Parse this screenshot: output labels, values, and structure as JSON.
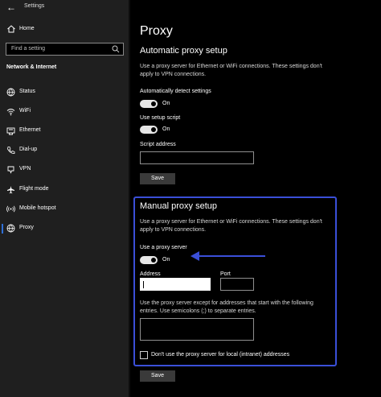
{
  "window": {
    "title": "Settings"
  },
  "sidebar": {
    "home_label": "Home",
    "search_placeholder": "Find a setting",
    "section_heading": "Network & Internet",
    "items": [
      {
        "label": "Status",
        "icon": "globe-icon"
      },
      {
        "label": "WiFi",
        "icon": "wifi-icon"
      },
      {
        "label": "Ethernet",
        "icon": "ethernet-icon"
      },
      {
        "label": "Dial-up",
        "icon": "phone-icon"
      },
      {
        "label": "VPN",
        "icon": "vpn-icon"
      },
      {
        "label": "Flight mode",
        "icon": "airplane-icon"
      },
      {
        "label": "Mobile hotspot",
        "icon": "hotspot-icon"
      },
      {
        "label": "Proxy",
        "icon": "globe-icon"
      }
    ],
    "selected_item": "Proxy"
  },
  "main": {
    "title": "Proxy",
    "automatic": {
      "heading": "Automatic proxy setup",
      "description": "Use a proxy server for Ethernet or WiFi connections. These settings don't apply to VPN connections.",
      "auto_detect_label": "Automatically detect settings",
      "auto_detect_state": "On",
      "setup_script_label": "Use setup script",
      "setup_script_state": "On",
      "script_address_label": "Script address",
      "script_address_value": "",
      "save_label": "Save"
    },
    "manual": {
      "heading": "Manual proxy setup",
      "description": "Use a proxy server for Ethernet or WiFi connections. These settings don't apply to VPN connections.",
      "use_proxy_label": "Use a proxy server",
      "use_proxy_state": "On",
      "address_label": "Address",
      "address_value": "",
      "port_label": "Port",
      "port_value": "",
      "exceptions_description": "Use the proxy server except for addresses that start with the following entries. Use semicolons (;) to separate entries.",
      "exceptions_value": "",
      "local_bypass_label": "Don't use the proxy server for local (intranet) addresses",
      "local_bypass_checked": false,
      "save_label": "Save"
    }
  },
  "colors": {
    "highlight_box": "#3a4fd8",
    "annotation_arrow": "#3a4fd8",
    "sidebar_bg": "#1f1f1f",
    "selection_accent": "#2f6fd6"
  }
}
